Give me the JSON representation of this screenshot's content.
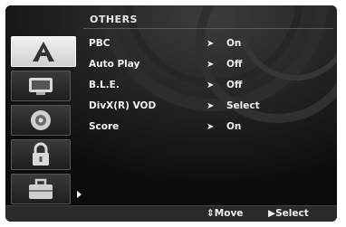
{
  "menu_title": "OTHERS",
  "sidebar": {
    "items": [
      {
        "icon": "language-a-icon",
        "active": true
      },
      {
        "icon": "display-icon",
        "active": false
      },
      {
        "icon": "speaker-icon",
        "active": false
      },
      {
        "icon": "lock-icon",
        "active": false
      },
      {
        "icon": "toolbox-icon",
        "active": false
      }
    ]
  },
  "settings": [
    {
      "label": "PBC",
      "pointer": "➤",
      "value": "On"
    },
    {
      "label": "Auto Play",
      "pointer": "➤",
      "value": "Off"
    },
    {
      "label": "B.L.E.",
      "pointer": "➤",
      "value": "Off"
    },
    {
      "label": "DivX(R) VOD",
      "pointer": "➤",
      "value": "Select"
    },
    {
      "label": "Score",
      "pointer": "➤",
      "value": "On"
    }
  ],
  "footer": {
    "move": "⇕Move",
    "select": "▶Select"
  }
}
